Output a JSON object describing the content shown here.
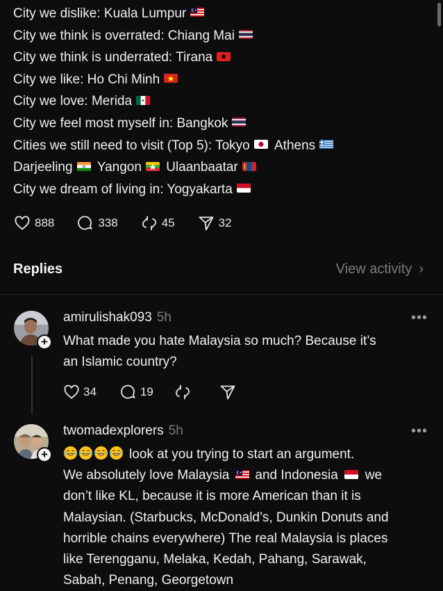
{
  "post": {
    "lines": [
      {
        "text": "City we dislike: Kuala Lumpur",
        "flag": "malaysia-flag"
      },
      {
        "text": "City we think is overrated: Chiang Mai",
        "flag": "thailand-flag"
      },
      {
        "text": "City we think is underrated: Tirana",
        "flag": "albania-flag"
      },
      {
        "text": "City we like: Ho Chi Minh",
        "flag": "vietnam-flag"
      },
      {
        "text": "City we love: Merida",
        "flag": "mexico-flag"
      },
      {
        "text": "City we feel most myself in: Bangkok",
        "flag": "thailand-flag"
      },
      {
        "segments": [
          {
            "text": "Cities we still need to visit (Top 5): Tokyo",
            "flag": "japan-flag"
          },
          {
            "text": "Athens",
            "flag": "greece-flag"
          }
        ]
      },
      {
        "segments": [
          {
            "text": "Darjeeling",
            "flag": "india-flag"
          },
          {
            "text": "Yangon",
            "flag": "myanmar-flag"
          },
          {
            "text": "Ulaanbaatar",
            "flag": "mongolia-flag"
          }
        ]
      },
      {
        "text": "City we dream of living in: Yogyakarta",
        "flag": "indonesia-flag"
      }
    ],
    "stats": {
      "likes": "888",
      "comments": "338",
      "reposts": "45",
      "shares": "32"
    }
  },
  "replies_header": {
    "title": "Replies",
    "view_activity": "View activity"
  },
  "replies": [
    {
      "username": "amirulishak093",
      "time": "5h",
      "text_lines": [
        "What made you hate Malaysia so much? Because it’s",
        "an Islamic country?"
      ],
      "stats": {
        "likes": "34",
        "comments": "19"
      }
    },
    {
      "username": "twomadexplorers",
      "time": "5h",
      "line1": "look at you trying to start an argument.",
      "line2a": "We absolutely love Malaysia",
      "line2b": "and Indonesia",
      "line2c": "we",
      "rest_lines": [
        "don’t like KL, because it is more American than it is",
        "Malaysian. (Starbucks, McDonald’s, Dunkin Donuts and",
        "horrible chains everywhere) The real Malaysia is places",
        "like Terengganu, Melaka, Kedah, Pahang, Sarawak,",
        "Sabah, Penang, Georgetown"
      ],
      "emoji": "laughing-tears-emoji"
    }
  ],
  "more_label": "•••",
  "plus_label": "+",
  "chevron": "›",
  "colors": {
    "background": "#0d0d0d",
    "text": "#f2f2f2",
    "muted": "#7c7c7c",
    "divider": "#262626"
  }
}
